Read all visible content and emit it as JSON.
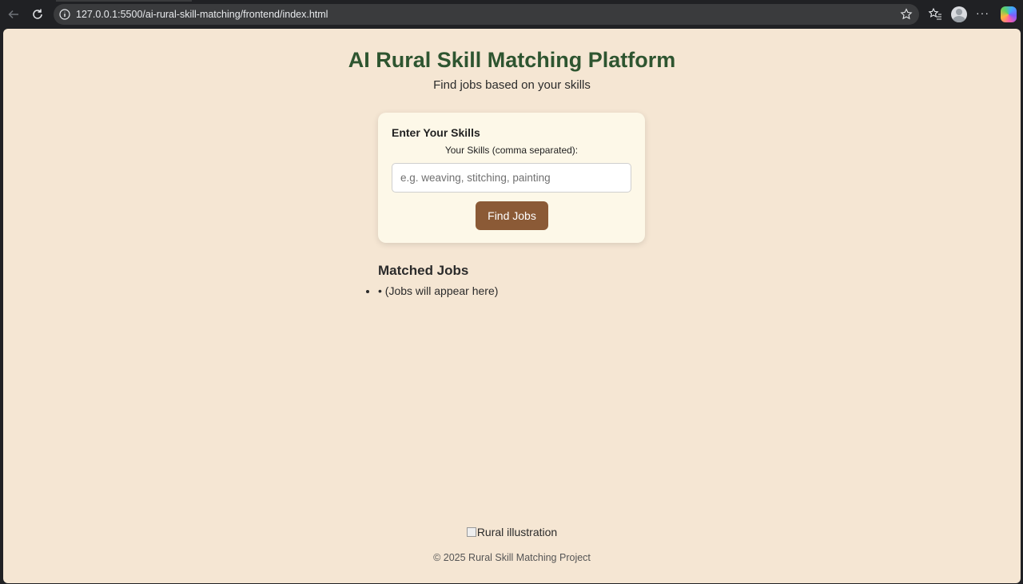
{
  "browser": {
    "url": "127.0.0.1:5500/ai-rural-skill-matching/frontend/index.html"
  },
  "page": {
    "title": "AI Rural Skill Matching Platform",
    "subtitle": "Find jobs based on your skills"
  },
  "skills_card": {
    "heading": "Enter Your Skills",
    "label": "Your Skills (comma separated):",
    "input_placeholder": "e.g. weaving, stitching, painting",
    "input_value": "",
    "button_label": "Find Jobs"
  },
  "jobs": {
    "heading": "Matched Jobs",
    "items": [
      "• (Jobs will appear here)"
    ]
  },
  "illustration_alt": "Rural illustration",
  "footer": "© 2025 Rural Skill Matching Project",
  "colors": {
    "page_bg": "#f5e6d3",
    "title": "#2e5530",
    "card_bg": "#fdf8e8",
    "button": "#8b5a36"
  }
}
